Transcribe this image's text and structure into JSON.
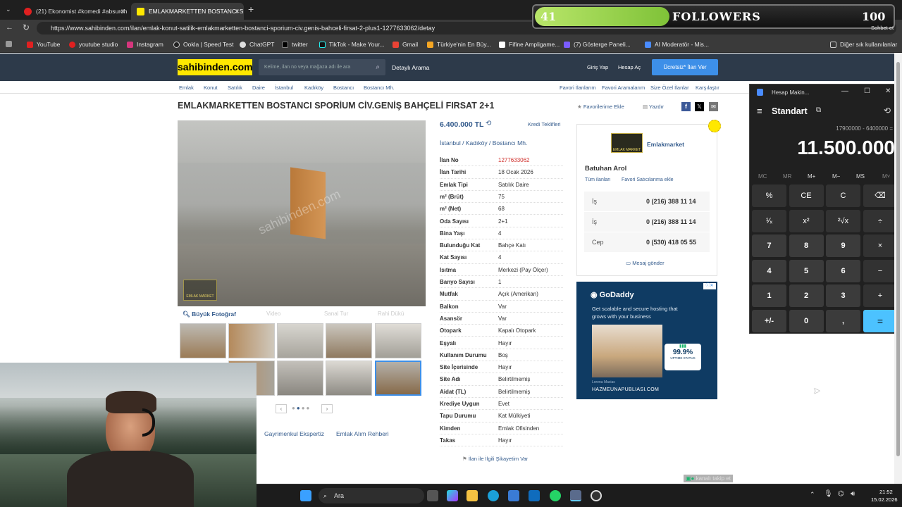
{
  "browser": {
    "tabs": [
      {
        "label": "(21) Ekonomist #komedi #absurdh"
      },
      {
        "label": "EMLAKMARKETTEN BOSTANCI SPO"
      }
    ],
    "url": "https://www.sahibinden.com/ilan/emlak-konut-satilik-emlakmarketten-bostanci-sporium-civ.genis-bahceli-firsat-2-plus1-1277633062/detay",
    "bookmarks": [
      "YouTube",
      "youtube studio",
      "Instagram",
      "Ookla | Speed Test",
      "ChatGPT",
      "twitter",
      "TikTok - Make Your...",
      "Gmail",
      "Türkiye'nin En Büy...",
      "Fifine Ampligame...",
      "(7) Gösterge Paneli...",
      "AI Moderatör - Mis...",
      "Diğer sık kullanılanlar"
    ],
    "sohbet": "Sohbet et"
  },
  "overlay": {
    "count_left": "41",
    "label": "FOLLOWERS",
    "count_right": "100",
    "progress": 0.41
  },
  "site": {
    "logo": "sahibinden.com",
    "search_placeholder": "Kelime, ilan no veya mağaza adı ile ara",
    "detailed_search": "Detaylı Arama",
    "login": "Giriş Yap",
    "register": "Hesap Aç",
    "post_ad": "Ücretsiz* İlan Ver",
    "breadcrumbs": [
      "Emlak",
      "Konut",
      "Satılık",
      "Daire",
      "İstanbul",
      "Kadıköy",
      "Bostancı",
      "Bostancı Mh."
    ],
    "top_links": [
      "Favori İlanlarım",
      "Favori Aramalarım",
      "Size Özel İlanlar",
      "Karşılaştır"
    ]
  },
  "listing": {
    "title": "EMLAKMARKETTEN BOSTANCI SPORİUM CİV.GENİŞ BAHÇELİ FIRSAT 2+1",
    "add_fav": "Favorilerime Ekle",
    "print": "Yazdır",
    "price": "6.400.000 TL",
    "credit": "Kredi Teklifleri",
    "location": [
      "İstanbul",
      "Kadıköy",
      "Bostancı Mh."
    ],
    "big_photo": "Büyük Fotoğraf",
    "media_tabs": [
      "Video",
      "Sanal Tur",
      "Rahi Dükü"
    ],
    "watermark": "sahibinden.com",
    "attributes": [
      {
        "k": "İlan No",
        "v": "1277633062"
      },
      {
        "k": "İlan Tarihi",
        "v": "18 Ocak 2026"
      },
      {
        "k": "Emlak Tipi",
        "v": "Satılık Daire"
      },
      {
        "k": "m² (Brüt)",
        "v": "75"
      },
      {
        "k": "m² (Net)",
        "v": "68"
      },
      {
        "k": "Oda Sayısı",
        "v": "2+1"
      },
      {
        "k": "Bina Yaşı",
        "v": "4"
      },
      {
        "k": "Bulunduğu Kat",
        "v": "Bahçe Katı"
      },
      {
        "k": "Kat Sayısı",
        "v": "4"
      },
      {
        "k": "Isıtma",
        "v": "Merkezi (Pay Ölçer)"
      },
      {
        "k": "Banyo Sayısı",
        "v": "1"
      },
      {
        "k": "Mutfak",
        "v": "Açık (Amerikan)"
      },
      {
        "k": "Balkon",
        "v": "Var"
      },
      {
        "k": "Asansör",
        "v": "Var"
      },
      {
        "k": "Otopark",
        "v": "Kapalı Otopark"
      },
      {
        "k": "Eşyalı",
        "v": "Hayır"
      },
      {
        "k": "Kullanım Durumu",
        "v": "Boş"
      },
      {
        "k": "Site İçerisinde",
        "v": "Hayır"
      },
      {
        "k": "Site Adı",
        "v": "Belirtilmemiş"
      },
      {
        "k": "Aidat (TL)",
        "v": "Belirtilmemiş"
      },
      {
        "k": "Krediye Uygun",
        "v": "Evet"
      },
      {
        "k": "Tapu Durumu",
        "v": "Kat Mülkiyeti"
      },
      {
        "k": "Kimden",
        "v": "Emlak Ofisinden"
      },
      {
        "k": "Takas",
        "v": "Hayır"
      }
    ],
    "complaint": "İlan ile İlgili Şikayetim Var",
    "links": [
      "Gayrimenkul Ekspertiz",
      "Emlak Alım Rehberi"
    ]
  },
  "seller": {
    "store": "Emlakmarket",
    "logo_text": "EMLAK MARKET",
    "name": "Batuhan Arol",
    "all_ads": "Tüm ilanları",
    "fav_seller": "Favori Satıcılarıma ekle",
    "phones": [
      {
        "type": "İş",
        "number": "0 (216) 388 11 14"
      },
      {
        "type": "İş",
        "number": "0 (216) 388 11 14"
      },
      {
        "type": "Cep",
        "number": "0 (530) 418 05 55"
      }
    ],
    "message": "Mesaj gönder"
  },
  "ad": {
    "brand": "GoDaddy",
    "text": "Get scalable and secure hosting that grows with your business",
    "uptime": "99.9%",
    "uptime_label": "UPTIME STATUS",
    "person": "Lorena Macias",
    "site": "HAZMEUNAPUBLIASI.COM"
  },
  "calculator": {
    "window_title": "Hesap Makin...",
    "mode": "Standart",
    "expression": "17900000 - 6400000 =",
    "result": "11.500.000",
    "memory": [
      "MC",
      "MR",
      "M+",
      "M−",
      "MS",
      "M˅"
    ],
    "keys": [
      "%",
      "CE",
      "C",
      "⌫",
      "¹⁄ₓ",
      "x²",
      "²√x",
      "÷",
      "7",
      "8",
      "9",
      "×",
      "4",
      "5",
      "6",
      "−",
      "1",
      "2",
      "3",
      "+",
      "+/-",
      "0",
      ",",
      "="
    ]
  },
  "taskbar": {
    "search": "Ara",
    "time": "21:52",
    "date": "15.02.2026"
  },
  "chat_overlay": "kanalı takip et"
}
